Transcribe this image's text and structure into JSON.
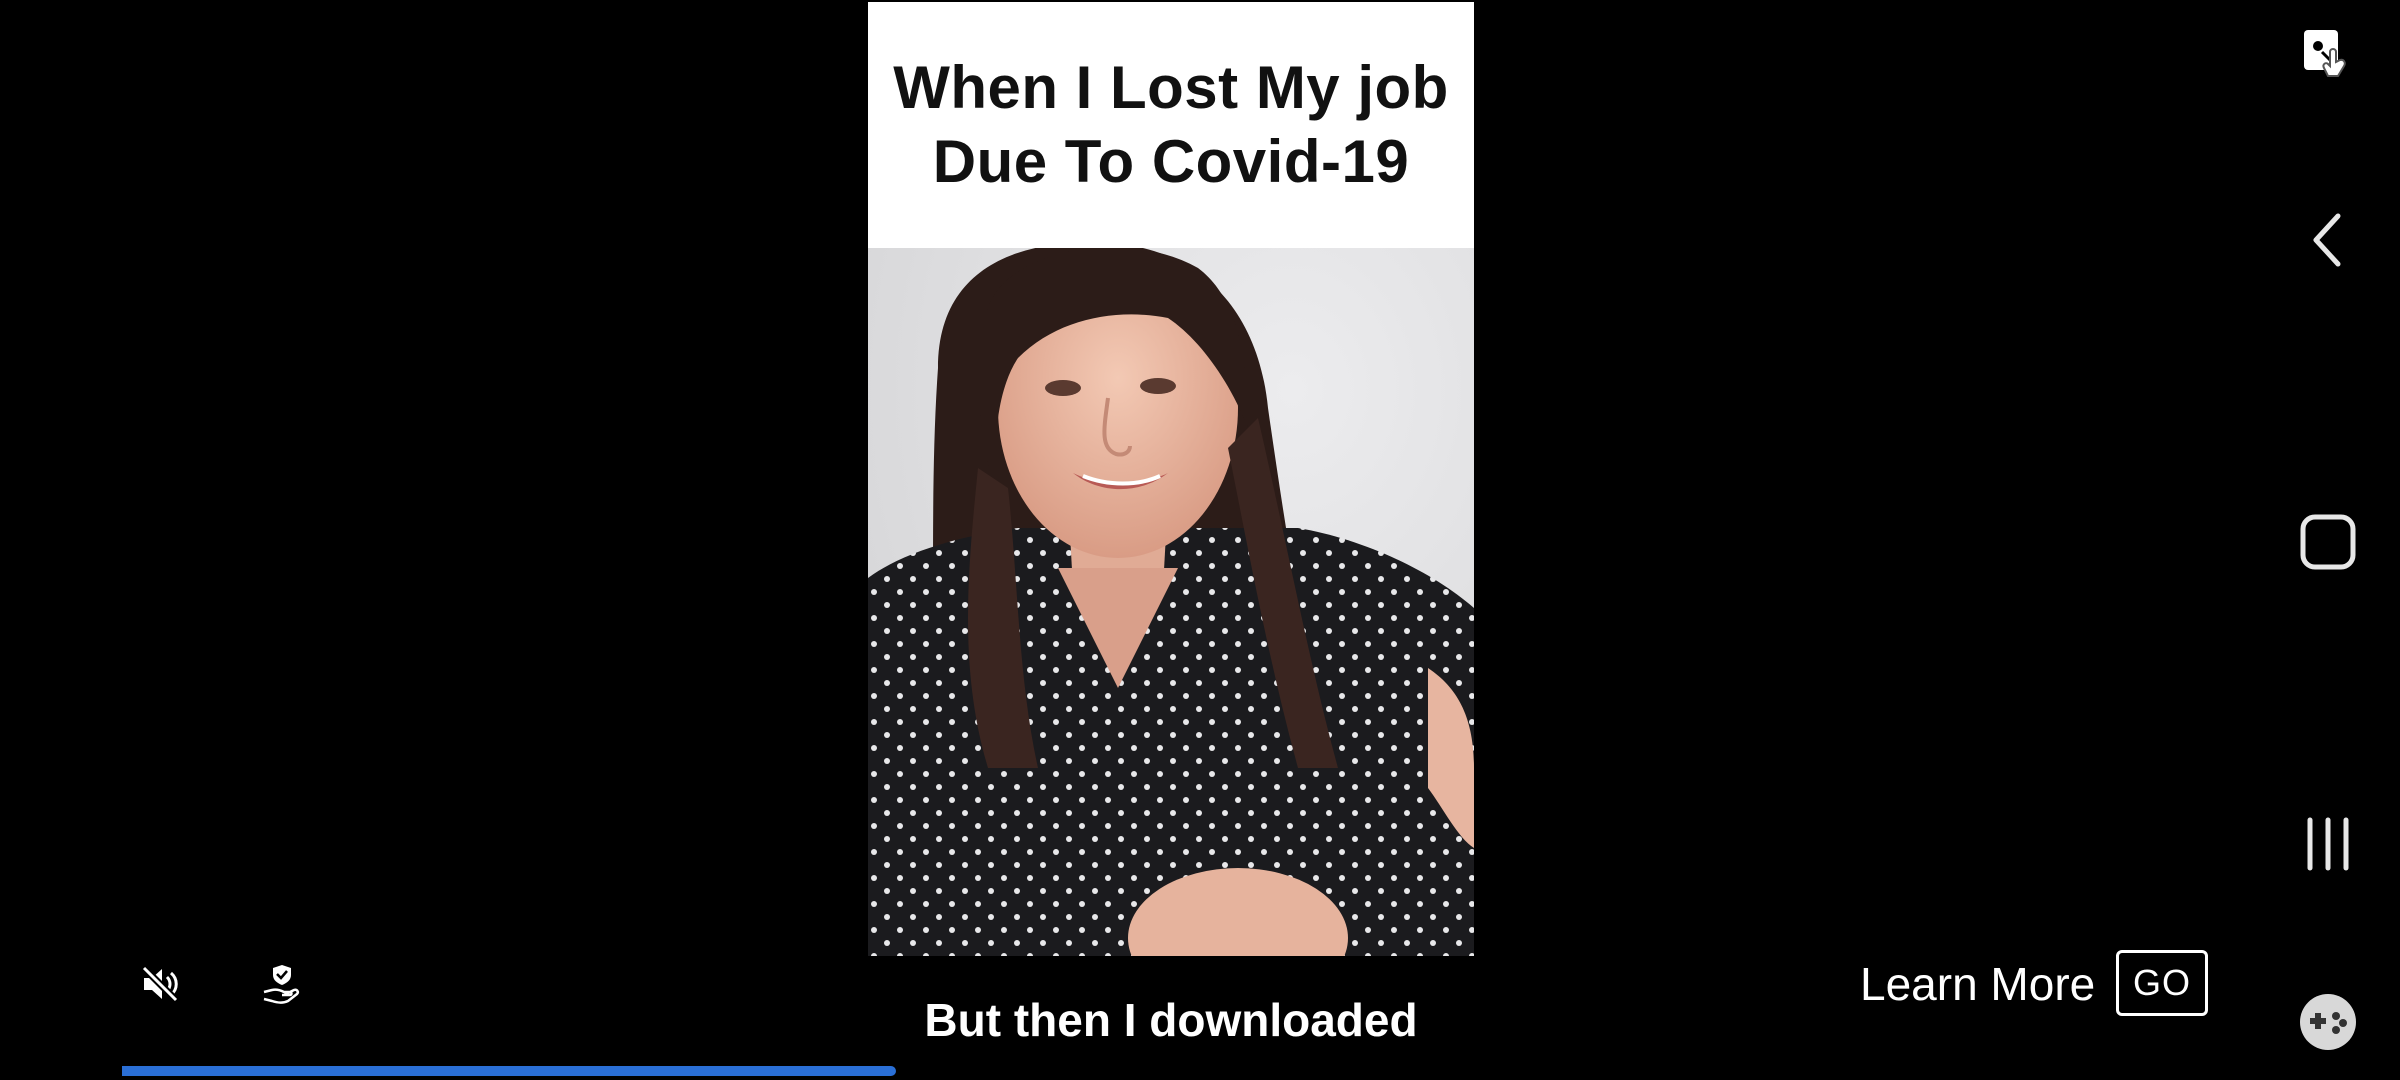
{
  "video": {
    "title_line1": "When I Lost My job",
    "title_line2": "Due To Covid-19",
    "caption": "But then I downloaded",
    "progress_fraction": 0.36
  },
  "controls": {
    "mute_icon": "volume-muted-icon",
    "privacy_icon": "hand-shield-icon"
  },
  "cta": {
    "learn_more_label": "Learn More",
    "go_label": "GO"
  },
  "nav": {
    "screenshot_icon": "screen-capture-icon",
    "back_icon": "chevron-left-icon",
    "home_icon": "square-home-icon",
    "recents_icon": "recent-apps-icon",
    "game_icon": "game-controller-icon"
  },
  "colors": {
    "background": "#000000",
    "progress": "#2a6fd6",
    "title_band": "#ffffff"
  }
}
